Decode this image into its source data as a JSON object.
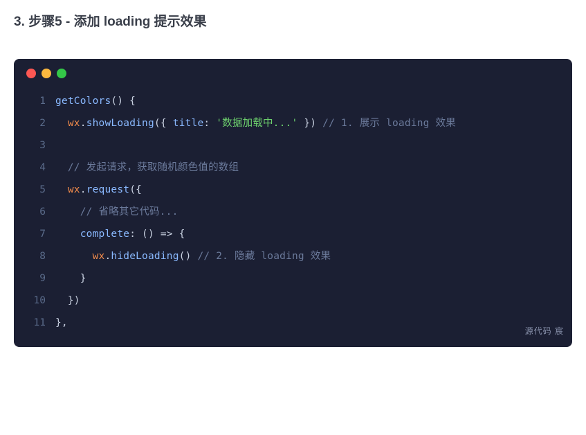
{
  "heading": "3. 步骤5 - 添加 loading 提示效果",
  "watermark": "源代码  宸",
  "code": {
    "lines": [
      {
        "num": "1",
        "tokens": [
          {
            "cls": "tok-fn",
            "text": "getColors"
          },
          {
            "cls": "tok-punct",
            "text": "() {"
          }
        ]
      },
      {
        "num": "2",
        "tokens": [
          {
            "cls": "tok-punct",
            "text": "  "
          },
          {
            "cls": "tok-obj",
            "text": "wx"
          },
          {
            "cls": "tok-punct",
            "text": "."
          },
          {
            "cls": "tok-method",
            "text": "showLoading"
          },
          {
            "cls": "tok-punct",
            "text": "({ "
          },
          {
            "cls": "tok-prop",
            "text": "title"
          },
          {
            "cls": "tok-punct",
            "text": ": "
          },
          {
            "cls": "tok-string",
            "text": "'数据加载中...'"
          },
          {
            "cls": "tok-punct",
            "text": " }) "
          },
          {
            "cls": "tok-comment",
            "text": "// 1. 展示 loading 效果"
          }
        ]
      },
      {
        "num": "3",
        "tokens": []
      },
      {
        "num": "4",
        "tokens": [
          {
            "cls": "tok-punct",
            "text": "  "
          },
          {
            "cls": "tok-comment",
            "text": "// 发起请求，获取随机颜色值的数组"
          }
        ]
      },
      {
        "num": "5",
        "tokens": [
          {
            "cls": "tok-punct",
            "text": "  "
          },
          {
            "cls": "tok-obj",
            "text": "wx"
          },
          {
            "cls": "tok-punct",
            "text": "."
          },
          {
            "cls": "tok-method",
            "text": "request"
          },
          {
            "cls": "tok-punct",
            "text": "({"
          }
        ]
      },
      {
        "num": "6",
        "tokens": [
          {
            "cls": "tok-punct",
            "text": "    "
          },
          {
            "cls": "tok-comment",
            "text": "// 省略其它代码..."
          }
        ]
      },
      {
        "num": "7",
        "tokens": [
          {
            "cls": "tok-punct",
            "text": "    "
          },
          {
            "cls": "tok-prop",
            "text": "complete"
          },
          {
            "cls": "tok-punct",
            "text": ": () "
          },
          {
            "cls": "tok-arrow",
            "text": "=>"
          },
          {
            "cls": "tok-punct",
            "text": " {"
          }
        ]
      },
      {
        "num": "8",
        "tokens": [
          {
            "cls": "tok-punct",
            "text": "      "
          },
          {
            "cls": "tok-obj",
            "text": "wx"
          },
          {
            "cls": "tok-punct",
            "text": "."
          },
          {
            "cls": "tok-method",
            "text": "hideLoading"
          },
          {
            "cls": "tok-punct",
            "text": "() "
          },
          {
            "cls": "tok-comment",
            "text": "// 2. 隐藏 loading 效果"
          }
        ]
      },
      {
        "num": "9",
        "tokens": [
          {
            "cls": "tok-punct",
            "text": "    }"
          }
        ]
      },
      {
        "num": "10",
        "tokens": [
          {
            "cls": "tok-punct",
            "text": "  })"
          }
        ]
      },
      {
        "num": "11",
        "tokens": [
          {
            "cls": "tok-punct",
            "text": "},"
          }
        ]
      }
    ]
  }
}
